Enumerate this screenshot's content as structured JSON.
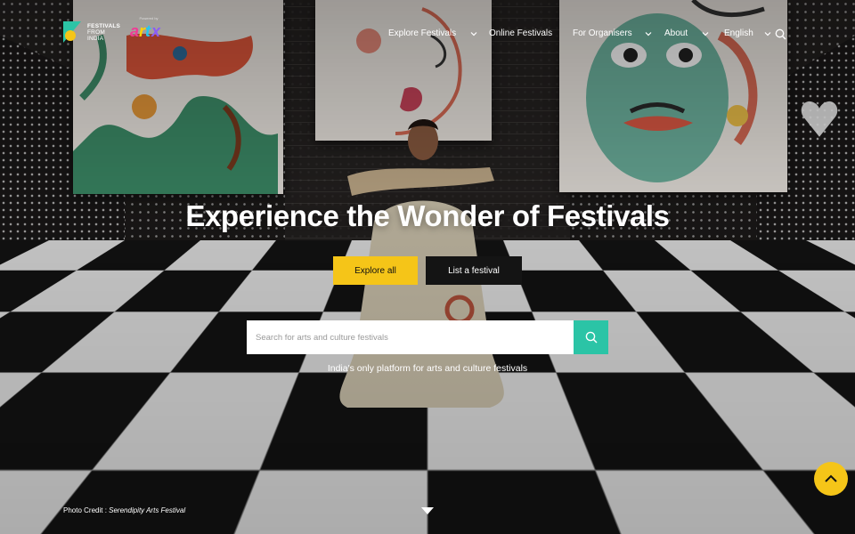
{
  "brand": {
    "logo_lines": [
      "FESTIVALS",
      "FROM",
      "INDIA"
    ],
    "partner_caption": "Powered by",
    "partner_name": "artx"
  },
  "nav": {
    "items": [
      {
        "label": "Explore Festivals",
        "has_dropdown": true
      },
      {
        "label": "Online Festivals",
        "has_dropdown": false
      },
      {
        "label": "For Organisers",
        "has_dropdown": true
      },
      {
        "label": "About",
        "has_dropdown": true
      },
      {
        "label": "English",
        "has_dropdown": true
      }
    ],
    "search_icon": "search-icon"
  },
  "hero": {
    "title": "Experience the Wonder of Festivals",
    "primary_button": "Explore all",
    "secondary_button": "List a festival",
    "search_placeholder": "Search for arts and culture festivals",
    "search_value": "",
    "tagline": "India's only platform for arts and culture festivals",
    "photo_credit_label": "Photo Credit : ",
    "photo_credit_name": "Serendipity Arts Festival"
  },
  "colors": {
    "accent_yellow": "#f5c518",
    "search_teal": "#2bc4a6",
    "secondary_button": "#141414",
    "logo_green": "#2bc4a6",
    "logo_yellow": "#f5c518"
  },
  "icons": {
    "scroll": "caret-down-icon",
    "back_to_top": "chevron-up-icon"
  }
}
